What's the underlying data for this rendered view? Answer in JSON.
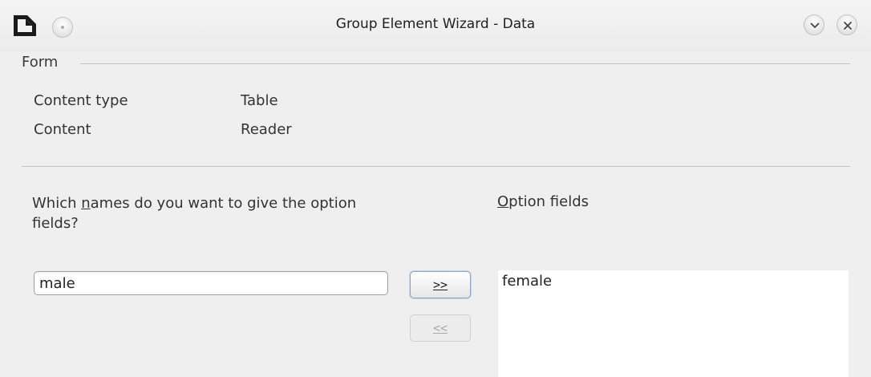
{
  "window": {
    "title": "Group Element Wizard - Data"
  },
  "form": {
    "group_label": "Form",
    "content_type_label": "Content type",
    "content_type_value": "Table",
    "content_label": "Content",
    "content_value": "Reader"
  },
  "names": {
    "question_pre": "Which ",
    "question_accel": "n",
    "question_post": "ames do you want to give the option fields?",
    "input_value": "male"
  },
  "option_fields": {
    "label_accel": "O",
    "label_rest": "ption fields",
    "items": [
      "female"
    ]
  },
  "buttons": {
    "add_label": ">>",
    "remove_label": "<<"
  },
  "icons": {
    "app": "document-icon",
    "menu": "window-menu-icon",
    "minimize": "minimize-icon",
    "close": "close-icon"
  }
}
